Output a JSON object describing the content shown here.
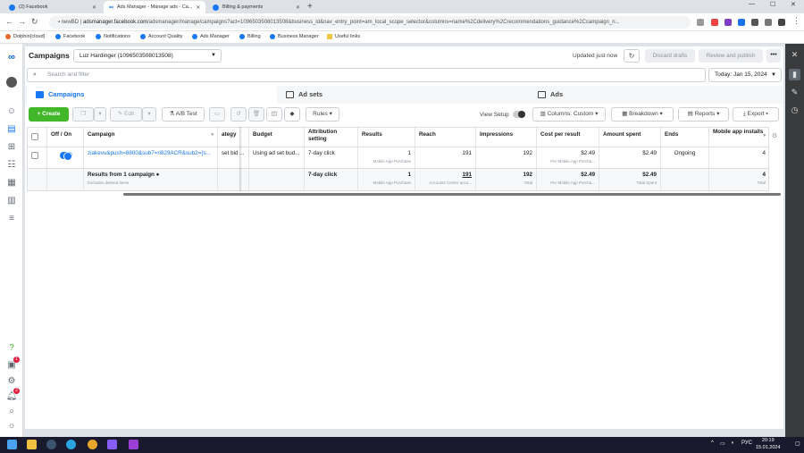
{
  "browser": {
    "tabs": [
      {
        "title": "(2) Facebook",
        "active": false
      },
      {
        "title": "Ads Manager - Manage ads - Ca...",
        "active": true
      },
      {
        "title": "Billing & payments",
        "active": false
      }
    ],
    "profile": "newBD",
    "url_host": "adsmanager.facebook.com",
    "url_path": "/adsmanager/manage/campaigns?act=1096503508013508&business_id&nav_entry_point=am_local_scope_selector&columns=name%2Cdelivery%2Crecommendations_guidance%2Ccampaign_n...",
    "bookmarks": [
      "Dolphin{cloud}",
      "Facebook",
      "Notifications",
      "Account Quality",
      "Ads Manager",
      "Billing",
      "Business Manager",
      "Useful links"
    ]
  },
  "header": {
    "title": "Campaigns",
    "account": "Luz Hardinger (1096503508013508)",
    "updated": "Updated just now",
    "discard_drafts": "Discard drafts",
    "review_publish": "Review and publish",
    "more": "•••"
  },
  "search": {
    "placeholder": "Search and filter",
    "date": "Today: Jan 15, 2024"
  },
  "level_tabs": {
    "campaigns": "Campaigns",
    "ad_sets": "Ad sets",
    "ads": "Ads"
  },
  "toolbar": {
    "create": "+ Create",
    "edit": "Edit",
    "ab_test": "A/B Test",
    "rules": "Rules",
    "view_setup": "View Setup",
    "columns": "Columns: Custom",
    "breakdown": "Breakdown",
    "reports": "Reports",
    "export": "Export"
  },
  "table": {
    "headers": {
      "off_on": "Off / On",
      "campaign": "Campaign",
      "strategy": "ategy",
      "budget": "Budget",
      "attribution": "Attribution setting",
      "results": "Results",
      "reach": "Reach",
      "impressions": "Impressions",
      "cost_per_result": "Cost per result",
      "amount_spent": "Amount spent",
      "ends": "Ends",
      "mobile_installs": "Mobile app installs"
    },
    "row": {
      "campaign": "ziakevu&push=8800&sub7=ri829ACR&sub2={s...",
      "strategy": "set bid ...",
      "budget": "Using ad set bud...",
      "attribution": "7-day click",
      "results": "1",
      "results_sub": "Mobile App Purchase",
      "reach": "191",
      "impressions": "192",
      "cost_per_result": "$2.49",
      "cost_per_result_sub": "Per Mobile App Purcha...",
      "amount_spent": "$2.49",
      "ends": "Ongoing",
      "mobile_installs": "4"
    },
    "total": {
      "label": "Results from 1 campaign",
      "sub": "Excludes deleted items",
      "attribution": "7-day click",
      "results": "1",
      "results_sub": "Mobile App Purchase",
      "reach": "191",
      "reach_sub": "Accounts Center acco...",
      "impressions": "192",
      "impressions_sub": "Total",
      "cost_per_result": "$2.49",
      "cost_per_result_sub": "Per Mobile App Purcha...",
      "amount_spent": "$2.49",
      "amount_spent_sub": "Total Spent",
      "mobile_installs": "4",
      "mobile_installs_sub": "Total"
    }
  },
  "left_nav_badges": {
    "notifications": "1",
    "alerts": "2"
  },
  "taskbar": {
    "lang": "РУС",
    "time": "20:19",
    "date": "15.01.2024"
  }
}
